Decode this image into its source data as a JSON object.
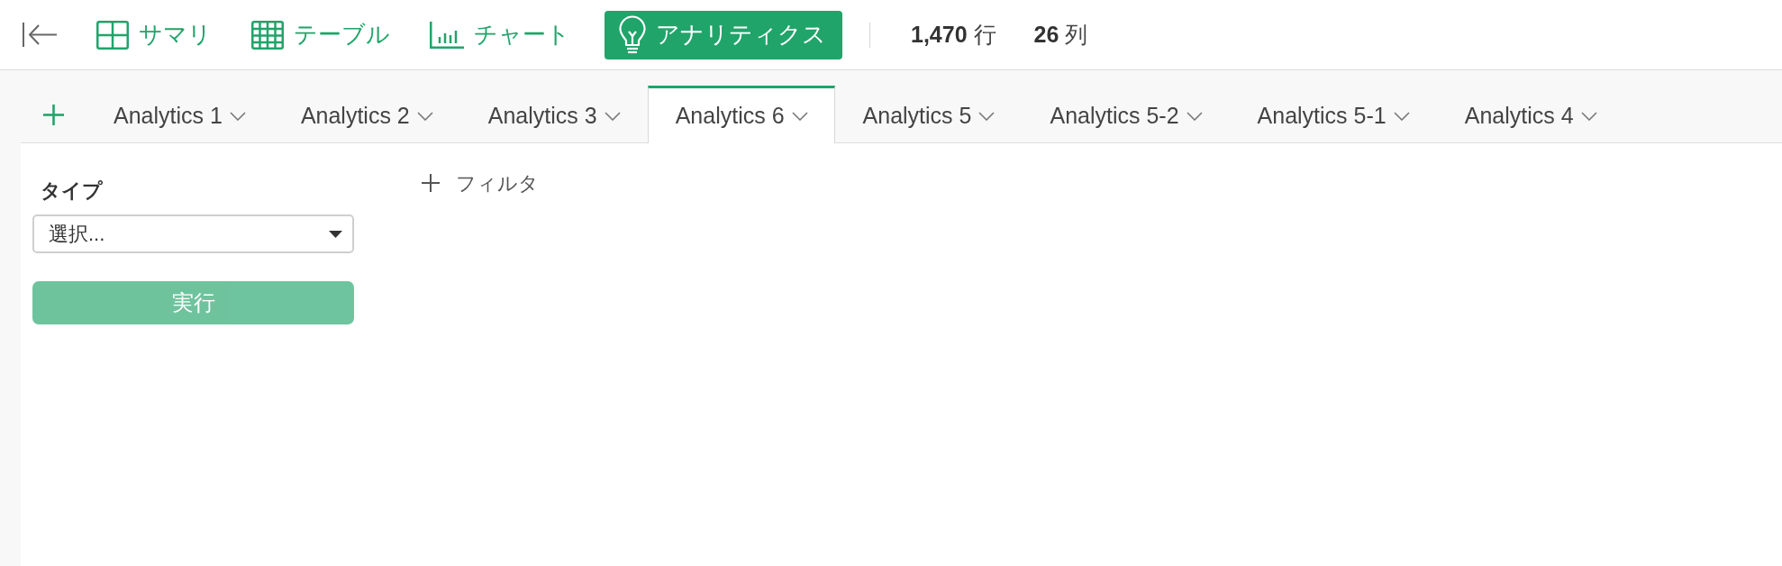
{
  "toolbar": {
    "views": [
      {
        "kind": "summary",
        "label": "サマリ",
        "selected": false
      },
      {
        "kind": "table",
        "label": "テーブル",
        "selected": false
      },
      {
        "kind": "chart",
        "label": "チャート",
        "selected": false
      },
      {
        "kind": "analytics",
        "label": "アナリティクス",
        "selected": true
      }
    ],
    "row_count": "**1,470** 行",
    "column_count": "**26** 列"
  },
  "tabs": [
    {
      "label": "Analytics 1",
      "selected": false
    },
    {
      "label": "Analytics 2",
      "selected": false
    },
    {
      "label": "Analytics 3",
      "selected": false
    },
    {
      "label": "Analytics 6",
      "selected": true
    },
    {
      "label": "Analytics 5",
      "selected": false
    },
    {
      "label": "Analytics 5-2",
      "selected": false
    },
    {
      "label": "Analytics 5-1",
      "selected": false
    },
    {
      "label": "Analytics 4",
      "selected": false
    }
  ],
  "side_panel": {
    "type_label": "タイプ",
    "type_select": {
      "value": "選択..."
    },
    "run_button": {
      "label": "実行",
      "disabled": true
    }
  },
  "filter_button": {
    "label": "フィルタ"
  }
}
